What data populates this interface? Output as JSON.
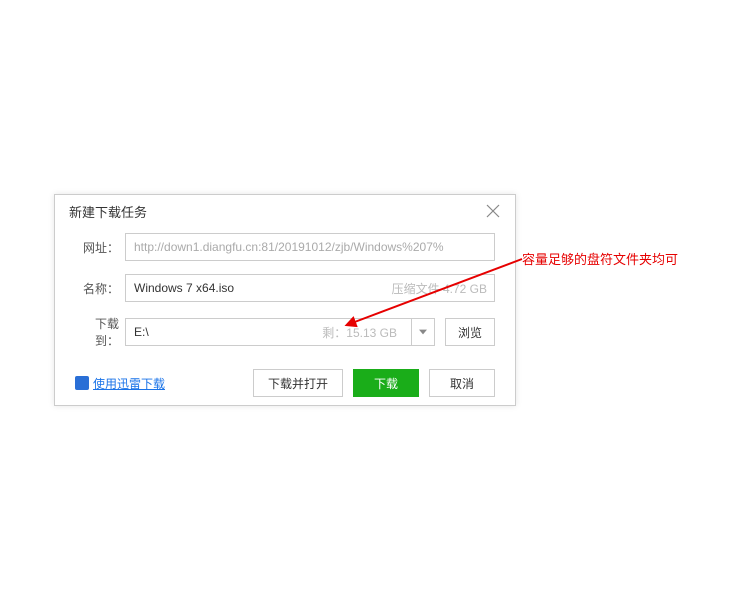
{
  "dialog": {
    "title": "新建下载任务",
    "url": {
      "label": "网址：",
      "value": "http://down1.diangfu.cn:81/20191012/zjb/Windows%207%"
    },
    "name": {
      "label": "名称：",
      "value": "Windows 7 x64.iso",
      "filetype_size": "压缩文件 4.72 GB"
    },
    "path": {
      "label": "下载到：",
      "value": "E:\\",
      "free": "剩：15.13 GB"
    },
    "browse": "浏览",
    "thunder_link": "使用迅雷下载",
    "buttons": {
      "open": "下载并打开",
      "download": "下载",
      "cancel": "取消"
    }
  },
  "annotation": {
    "text": "容量足够的盘符文件夹均可",
    "color": "#e60000"
  }
}
